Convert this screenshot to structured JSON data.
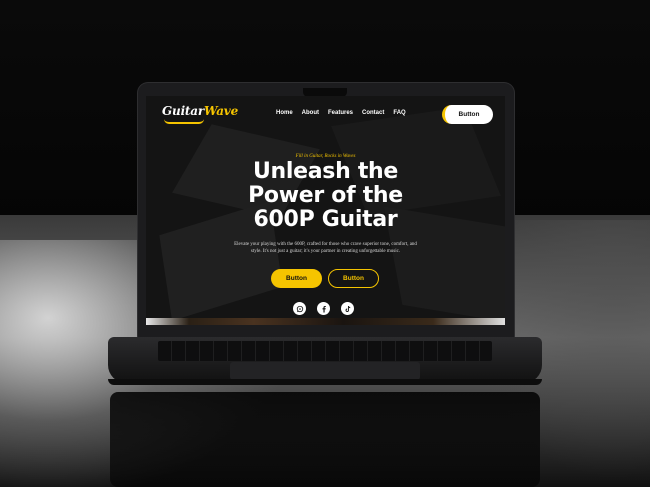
{
  "site": {
    "logo": {
      "text_main": "Guitar",
      "text_accent": "Wave"
    },
    "nav": {
      "links": [
        "Home",
        "About",
        "Features",
        "Contact",
        "FAQ"
      ],
      "button_label": "Button"
    },
    "hero": {
      "tagline": "Fill in Guitar, Rocks in Waves",
      "headline_lines": [
        "Unleash the",
        "Power of the",
        "600P Guitar"
      ],
      "description": "Elevate your playing with the 600P, crafted for those who crave superior tone, comfort, and style. It's not just a guitar; it's your partner in creating unforgettable music.",
      "primary_button": "Button",
      "secondary_button": "Button"
    },
    "socials": [
      "whatsapp-icon",
      "facebook-icon",
      "tiktok-icon"
    ]
  },
  "colors": {
    "accent": "#f5c400",
    "background": "#141414",
    "text": "#ffffff"
  }
}
